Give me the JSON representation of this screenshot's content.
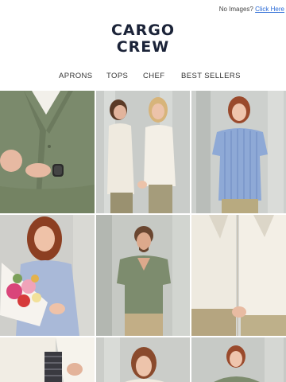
{
  "topbar": {
    "text": "No Images?",
    "link": "Click Here"
  },
  "brand": {
    "line1": "CARGO",
    "line2": "CREW"
  },
  "nav": [
    {
      "label": "APRONS"
    },
    {
      "label": "TOPS"
    },
    {
      "label": "CHEF"
    },
    {
      "label": "BEST SELLERS"
    }
  ],
  "colors": {
    "brand_navy": "#1b2338",
    "link_blue": "#2a6ad6",
    "olive_shirt": "#7d8c6e",
    "cream_shirt": "#f0ece2",
    "striped_blue": "#8ea9d6"
  },
  "tiles": [
    {
      "name": "photo-olive-shirt-closeup"
    },
    {
      "name": "photo-two-women-cream-shirts"
    },
    {
      "name": "photo-woman-striped-blue-shirt"
    },
    {
      "name": "photo-woman-with-flowers"
    },
    {
      "name": "photo-man-olive-shirt"
    },
    {
      "name": "photo-cream-shirts-holding-hands"
    },
    {
      "name": "photo-cream-shirt-bottom-left"
    },
    {
      "name": "photo-woman-cream-shirt-bottom"
    },
    {
      "name": "photo-woman-olive-shirt-bottom"
    }
  ]
}
